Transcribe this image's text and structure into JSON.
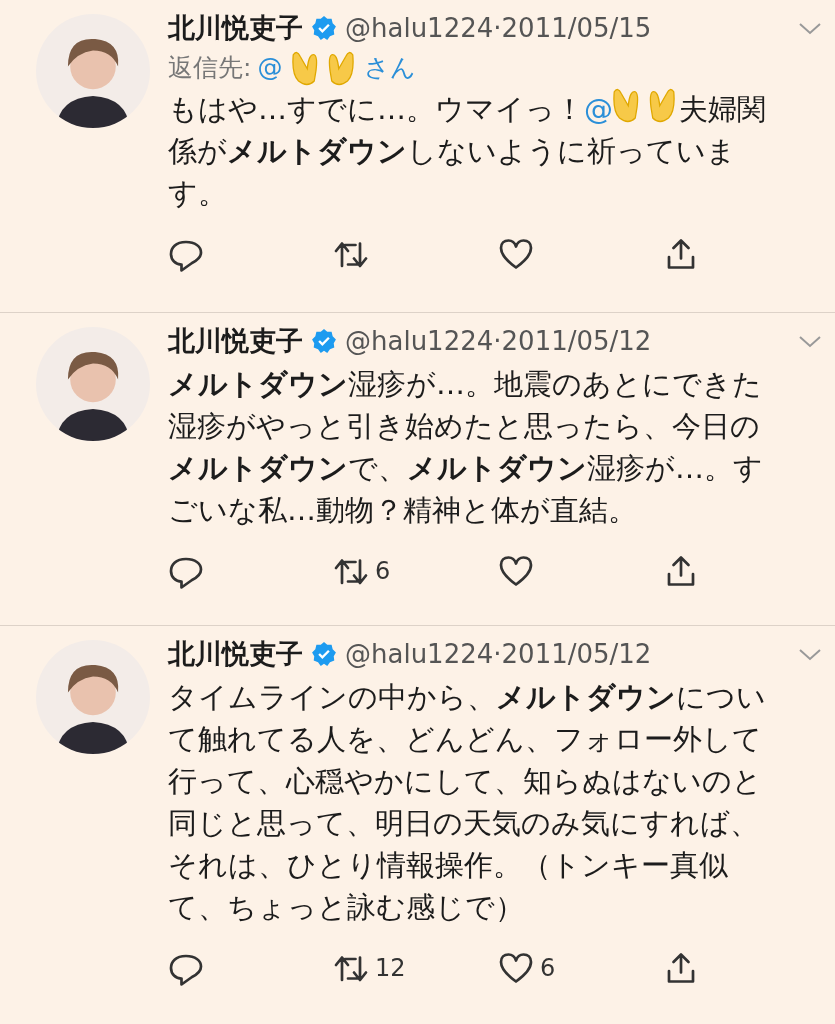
{
  "tweets": [
    {
      "name": "北川悦吏子",
      "verified": true,
      "handle": "@halu1224",
      "separator": "·",
      "date": "2011/05/15",
      "reply_to": {
        "label": "返信先:",
        "mention": "@",
        "suffix": "さん"
      },
      "body": [
        {
          "kind": "text",
          "text": "もはや…すでに…。ウマイっ！"
        },
        {
          "kind": "mention",
          "text": "@"
        },
        {
          "kind": "cover"
        },
        {
          "kind": "text",
          "text": "夫婦関係が**メルトダウン**しないように祈っています。"
        }
      ],
      "actions": [
        {
          "kind": "reply"
        },
        {
          "kind": "retweet"
        },
        {
          "kind": "like"
        },
        {
          "kind": "share"
        }
      ]
    },
    {
      "name": "北川悦吏子",
      "verified": true,
      "handle": "@halu1224",
      "separator": "·",
      "date": "2011/05/12",
      "body": [
        {
          "kind": "text",
          "text": "**メルトダウン**湿疹が…。地震のあとにできた湿疹がやっと引き始めたと思ったら、今日の**メルトダウン**で、**メルトダウン**湿疹が…。すごいな私…動物？精神と体が直結。"
        }
      ],
      "actions": [
        {
          "kind": "reply"
        },
        {
          "kind": "retweet",
          "count": "6"
        },
        {
          "kind": "like"
        },
        {
          "kind": "share"
        }
      ]
    },
    {
      "name": "北川悦吏子",
      "verified": true,
      "handle": "@halu1224",
      "separator": "·",
      "date": "2011/05/12",
      "body": [
        {
          "kind": "text",
          "text": "タイムラインの中から、**メルトダウン**について触れてる人を、どんどん、フォロー外して行って、心穏やかにして、知らぬはないのと同じと思って、明日の天気のみ気にすれば、それは、ひとり情報操作。（トンキー真似て、ちょっと詠む感じで）"
        }
      ],
      "actions": [
        {
          "kind": "reply"
        },
        {
          "kind": "retweet",
          "count": "12"
        },
        {
          "kind": "like",
          "count": "6"
        },
        {
          "kind": "share"
        }
      ]
    }
  ]
}
